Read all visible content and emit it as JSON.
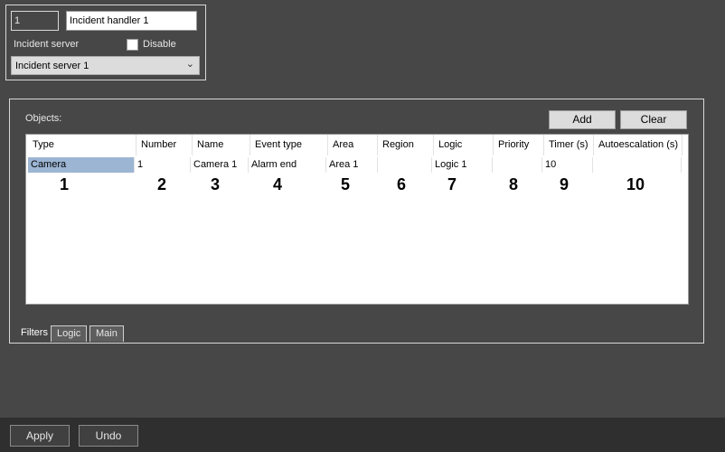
{
  "header": {
    "id_value": "1",
    "name_value": "Incident handler 1",
    "incident_server_label": "Incident server",
    "disable_label": "Disable",
    "server_select_value": "Incident server 1"
  },
  "objects": {
    "label": "Objects:",
    "add_label": "Add",
    "clear_label": "Clear",
    "columns": [
      "Type",
      "Number",
      "Name",
      "Event type",
      "Area",
      "Region",
      "Logic",
      "Priority",
      "Timer (s)",
      "Autoescalation (s)"
    ],
    "rows": [
      [
        "Camera",
        "1",
        "Camera 1",
        "Alarm end",
        "Area 1",
        "",
        "Logic 1",
        "",
        "10",
        ""
      ]
    ],
    "column_numbers": [
      "1",
      "2",
      "3",
      "4",
      "5",
      "6",
      "7",
      "8",
      "9",
      "10"
    ]
  },
  "tabs": [
    "Filters",
    "Logic",
    "Main"
  ],
  "footer": {
    "apply_label": "Apply",
    "undo_label": "Undo"
  }
}
